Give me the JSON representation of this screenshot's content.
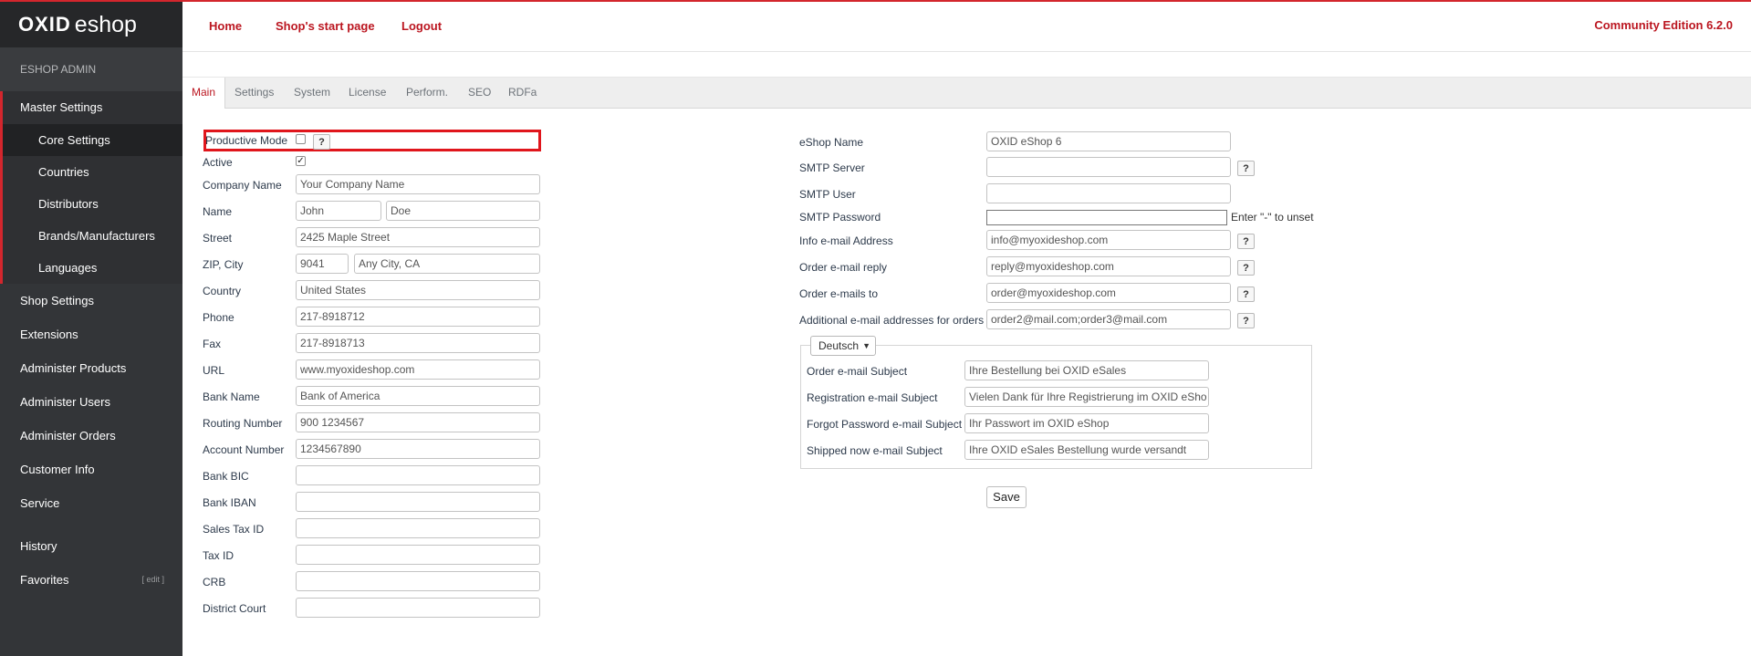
{
  "app": {
    "logo_bold": "OXID",
    "logo_light": "eshop",
    "admin_title": "ESHOP ADMIN"
  },
  "header": {
    "nav": [
      "Home",
      "Shop's start page",
      "Logout"
    ],
    "edition": "Community Edition 6.2.0"
  },
  "sidebar": {
    "master": "Master Settings",
    "master_sub": [
      "Core Settings",
      "Countries",
      "Distributors",
      "Brands/Manufacturers",
      "Languages"
    ],
    "items": [
      "Shop Settings",
      "Extensions",
      "Administer Products",
      "Administer Users",
      "Administer Orders",
      "Customer Info",
      "Service"
    ],
    "history": "History",
    "favorites": "Favorites",
    "favorites_edit": "[ edit ]"
  },
  "tabs": [
    "Main",
    "Settings",
    "System",
    "License",
    "Perform.",
    "SEO",
    "RDFa"
  ],
  "left_form": {
    "productive_mode": "Productive Mode",
    "help": "?",
    "active": "Active",
    "company_name": {
      "label": "Company Name",
      "value": "Your Company Name"
    },
    "name": {
      "label": "Name",
      "first": "John",
      "last": "Doe"
    },
    "street": {
      "label": "Street",
      "value": "2425 Maple Street"
    },
    "zip_city": {
      "label": "ZIP, City",
      "zip": "9041",
      "city": "Any City, CA"
    },
    "country": {
      "label": "Country",
      "value": "United States"
    },
    "phone": {
      "label": "Phone",
      "value": "217-8918712"
    },
    "fax": {
      "label": "Fax",
      "value": "217-8918713"
    },
    "url": {
      "label": "URL",
      "value": "www.myoxideshop.com"
    },
    "bank_name": {
      "label": "Bank Name",
      "value": "Bank of America"
    },
    "routing": {
      "label": "Routing Number",
      "value": "900 1234567"
    },
    "account": {
      "label": "Account Number",
      "value": "1234567890"
    },
    "bic": {
      "label": "Bank BIC",
      "value": ""
    },
    "iban": {
      "label": "Bank IBAN",
      "value": ""
    },
    "sales_tax": {
      "label": "Sales Tax ID",
      "value": ""
    },
    "tax_id": {
      "label": "Tax ID",
      "value": ""
    },
    "crb": {
      "label": "CRB",
      "value": ""
    },
    "district": {
      "label": "District Court",
      "value": ""
    }
  },
  "right_form": {
    "eshop_name": {
      "label": "eShop Name",
      "value": "OXID eShop 6"
    },
    "smtp_server": {
      "label": "SMTP Server",
      "value": ""
    },
    "smtp_user": {
      "label": "SMTP User",
      "value": ""
    },
    "smtp_password": {
      "label": "SMTP Password",
      "value": "",
      "hint": "Enter \"-\" to unset"
    },
    "info_email": {
      "label": "Info e-mail Address",
      "value": "info@myoxideshop.com"
    },
    "order_reply": {
      "label": "Order e-mail reply",
      "value": "reply@myoxideshop.com"
    },
    "order_to": {
      "label": "Order e-mails to",
      "value": "order@myoxideshop.com"
    },
    "additional": {
      "label": "Additional e-mail addresses for orders",
      "value": "order2@mail.com;order3@mail.com"
    },
    "language": "Deutsch",
    "order_subject": {
      "label": "Order e-mail Subject",
      "value": "Ihre Bestellung bei OXID eSales"
    },
    "reg_subject": {
      "label": "Registration e-mail Subject",
      "value": "Vielen Dank für Ihre Registrierung im OXID eSho"
    },
    "forgot_subject": {
      "label": "Forgot Password e-mail Subject",
      "value": "Ihr Passwort im OXID eShop"
    },
    "shipped_subject": {
      "label": "Shipped now e-mail Subject",
      "value": "Ihre OXID eSales Bestellung wurde versandt"
    },
    "save": "Save"
  }
}
